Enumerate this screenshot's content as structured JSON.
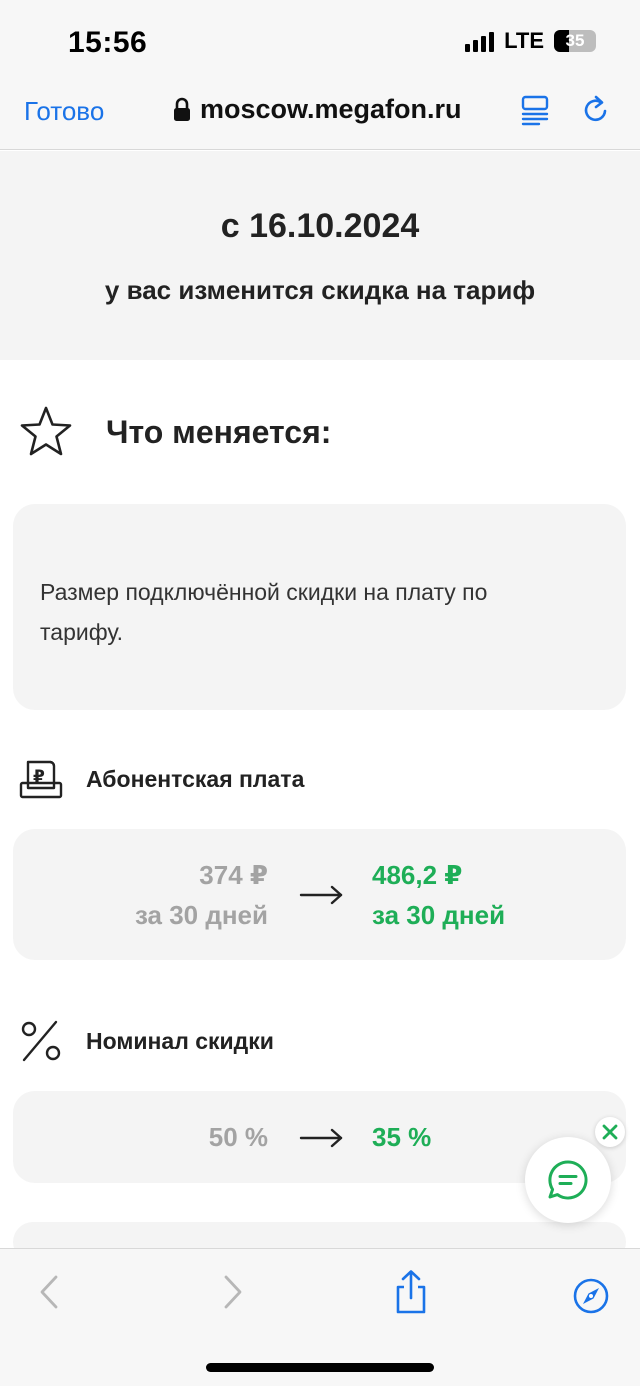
{
  "status_bar": {
    "time": "15:56",
    "network": "LTE",
    "battery": "35",
    "battery_level": 0.35
  },
  "browser": {
    "done_label": "Готово",
    "url": "moscow.megafon.ru",
    "lock_icon": "lock-icon",
    "reader_icon": "reader-icon",
    "reload_icon": "reload-icon",
    "accent_color": "#1a73e8"
  },
  "banner": {
    "date": "с 16.10.2024",
    "subtitle": "у вас изменится скидка на тариф"
  },
  "section": {
    "title": "Что меняется:",
    "icon": "star-icon"
  },
  "description": {
    "text": "Размер подключённой скидки на плату по тарифу."
  },
  "subscription_fee": {
    "title": "Абонентская плата",
    "icon": "ruble-receipt-icon",
    "old_value": "374 ₽",
    "old_period": "за 30 дней",
    "new_value": "486,2 ₽",
    "new_period": "за 30 дней"
  },
  "discount": {
    "title": "Номинал скидки",
    "icon": "percent-icon",
    "old_value": "50 %",
    "new_value": "35 %"
  },
  "colors": {
    "green": "#1eae57",
    "grey_text": "#a3a3a3"
  },
  "toolbar": {
    "back_icon": "back-chevron-icon",
    "forward_icon": "forward-chevron-icon",
    "share_icon": "share-icon",
    "compass_icon": "compass-icon"
  }
}
